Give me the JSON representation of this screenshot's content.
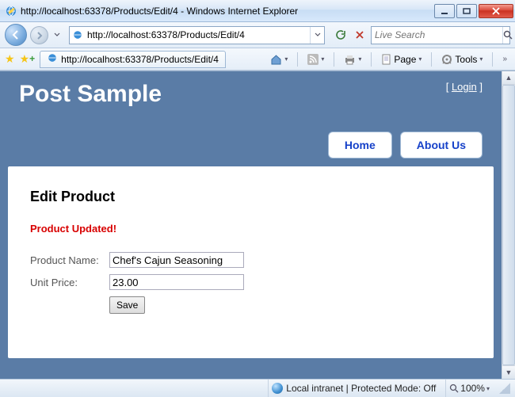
{
  "window": {
    "title": "http://localhost:63378/Products/Edit/4 - Windows Internet Explorer"
  },
  "address": {
    "url": "http://localhost:63378/Products/Edit/4"
  },
  "search": {
    "placeholder": "Live Search"
  },
  "tab": {
    "label": "http://localhost:63378/Products/Edit/4"
  },
  "cmdbar": {
    "page_label": "Page",
    "tools_label": "Tools"
  },
  "site": {
    "title": "Post Sample",
    "login_prefix": "[ ",
    "login_link": "Login",
    "login_suffix": " ]",
    "nav": {
      "home": "Home",
      "about": "About Us"
    }
  },
  "content": {
    "heading": "Edit Product",
    "message": "Product Updated!",
    "labels": {
      "name": "Product Name:",
      "price": "Unit Price:"
    },
    "values": {
      "name": "Chef's Cajun Seasoning",
      "price": "23.00"
    },
    "save_label": "Save"
  },
  "status": {
    "zone": "Local intranet | Protected Mode: Off",
    "zoom": "100%"
  }
}
